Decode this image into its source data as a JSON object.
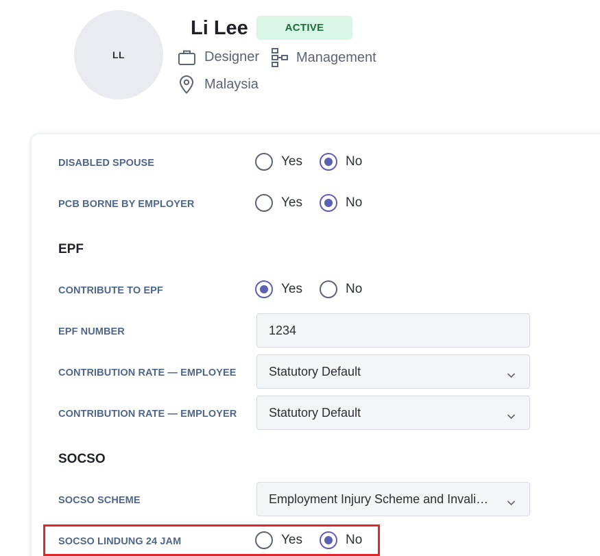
{
  "profile": {
    "initials": "LL",
    "name": "Li Lee",
    "status": "ACTIVE",
    "role": "Designer",
    "department": "Management",
    "country": "Malaysia"
  },
  "form": {
    "disabled_spouse": {
      "label": "DISABLED SPOUSE",
      "options": [
        "Yes",
        "No"
      ],
      "selected": "No"
    },
    "pcb_borne": {
      "label": "PCB BORNE BY EMPLOYER",
      "options": [
        "Yes",
        "No"
      ],
      "selected": "No"
    },
    "epf": {
      "heading": "EPF",
      "contribute": {
        "label": "CONTRIBUTE TO EPF",
        "options": [
          "Yes",
          "No"
        ],
        "selected": "Yes"
      },
      "number": {
        "label": "EPF NUMBER",
        "value": "1234"
      },
      "rate_employee": {
        "label": "CONTRIBUTION RATE — EMPLOYEE",
        "value": "Statutory Default"
      },
      "rate_employer": {
        "label": "CONTRIBUTION RATE — EMPLOYER",
        "value": "Statutory Default"
      }
    },
    "socso": {
      "heading": "SOCSO",
      "scheme": {
        "label": "SOCSO SCHEME",
        "value": "Employment Injury Scheme and Invalidit…"
      },
      "lindung": {
        "label": "SOCSO LINDUNG 24 JAM",
        "options": [
          "Yes",
          "No"
        ],
        "selected": "No"
      }
    }
  },
  "colors": {
    "accent": "#5d5fb3",
    "badge_bg": "#d9f5e5",
    "badge_text": "#1e6b3c",
    "highlight": "#e0262b"
  }
}
